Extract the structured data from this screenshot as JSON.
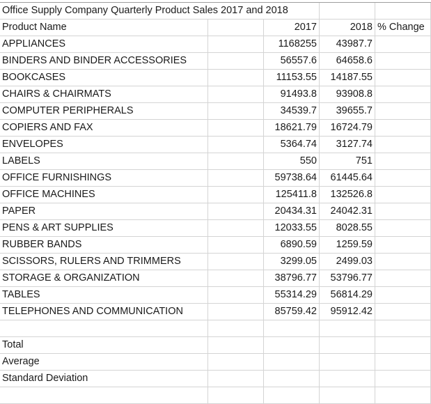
{
  "sheet": {
    "title": "Office Supply Company Quarterly Product Sales 2017 and 2018",
    "headers": {
      "product": "Product Name",
      "y2017": "2017",
      "y2018": "2018",
      "change": "% Change"
    },
    "rows": [
      {
        "name": "APPLIANCES",
        "y2017": "1168255",
        "y2018": "43987.7",
        "change": ""
      },
      {
        "name": "BINDERS AND BINDER ACCESSORIES",
        "y2017": "56557.6",
        "y2018": "64658.6",
        "change": ""
      },
      {
        "name": "BOOKCASES",
        "y2017": "11153.55",
        "y2018": "14187.55",
        "change": ""
      },
      {
        "name": "CHAIRS & CHAIRMATS",
        "y2017": "91493.8",
        "y2018": "93908.8",
        "change": ""
      },
      {
        "name": "COMPUTER PERIPHERALS",
        "y2017": "34539.7",
        "y2018": "39655.7",
        "change": ""
      },
      {
        "name": "COPIERS AND FAX",
        "y2017": "18621.79",
        "y2018": "16724.79",
        "change": ""
      },
      {
        "name": "ENVELOPES",
        "y2017": "5364.74",
        "y2018": "3127.74",
        "change": ""
      },
      {
        "name": "LABELS",
        "y2017": "550",
        "y2018": "751",
        "change": ""
      },
      {
        "name": "OFFICE FURNISHINGS",
        "y2017": "59738.64",
        "y2018": "61445.64",
        "change": ""
      },
      {
        "name": "OFFICE MACHINES",
        "y2017": "125411.8",
        "y2018": "132526.8",
        "change": ""
      },
      {
        "name": "PAPER",
        "y2017": "20434.31",
        "y2018": "24042.31",
        "change": ""
      },
      {
        "name": "PENS & ART SUPPLIES",
        "y2017": "12033.55",
        "y2018": "8028.55",
        "change": ""
      },
      {
        "name": "RUBBER BANDS",
        "y2017": "6890.59",
        "y2018": "1259.59",
        "change": ""
      },
      {
        "name": "SCISSORS, RULERS AND TRIMMERS",
        "y2017": "3299.05",
        "y2018": "2499.03",
        "change": ""
      },
      {
        "name": "STORAGE & ORGANIZATION",
        "y2017": "38796.77",
        "y2018": "53796.77",
        "change": ""
      },
      {
        "name": "TABLES",
        "y2017": "55314.29",
        "y2018": "56814.29",
        "change": ""
      },
      {
        "name": "TELEPHONES AND COMMUNICATION",
        "y2017": "85759.42",
        "y2018": "95912.42",
        "change": ""
      }
    ],
    "summary": {
      "total": "Total",
      "average": "Average",
      "std_dev": "Standard Deviation"
    }
  }
}
